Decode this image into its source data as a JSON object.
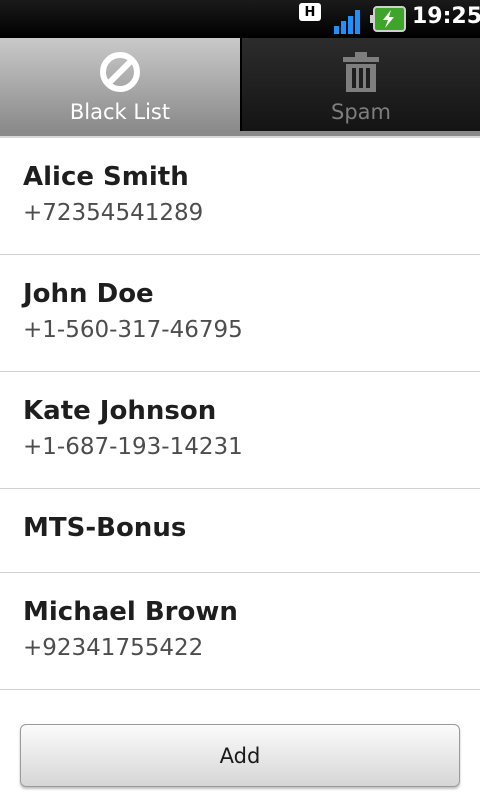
{
  "status_bar": {
    "network_badge": "H",
    "time": "19:25",
    "icons": [
      "network-h-icon",
      "signal-strength-icon",
      "battery-charging-icon"
    ]
  },
  "tabs": [
    {
      "label": "Black List",
      "icon": "block-icon",
      "active": true
    },
    {
      "label": "Spam",
      "icon": "trash-icon",
      "active": false
    }
  ],
  "contacts": [
    {
      "name": "Alice Smith",
      "phone": "+72354541289"
    },
    {
      "name": "John Doe",
      "phone": "+1-560-317-46795"
    },
    {
      "name": "Kate Johnson",
      "phone": "+1-687-193-14231"
    },
    {
      "name": "MTS-Bonus",
      "phone": ""
    },
    {
      "name": "Michael Brown",
      "phone": "+92341755422"
    }
  ],
  "add_button": {
    "label": "Add"
  },
  "colors": {
    "battery_green": "#3fa52a",
    "signal_blue": "#1e90ff"
  }
}
